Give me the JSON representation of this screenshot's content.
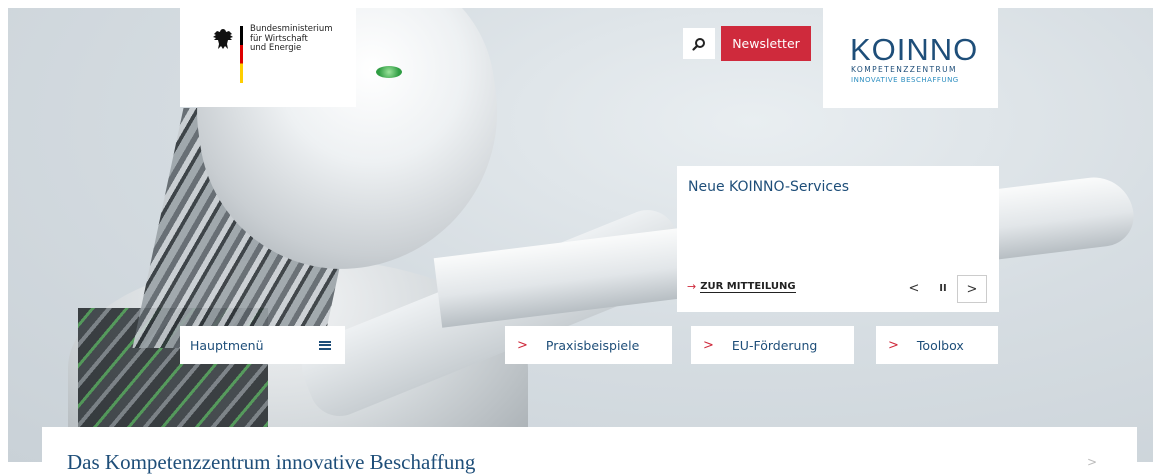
{
  "ministry": {
    "lines": [
      "Bundesministerium",
      "für Wirtschaft",
      "und Energie"
    ]
  },
  "header": {
    "search_icon": "search-icon",
    "newsletter_label": "Newsletter"
  },
  "logo": {
    "word": "KOINNO",
    "line1": "KOMPETENZZENTRUM",
    "line2": "INNOVATIVE BESCHAFFUNG"
  },
  "teaser": {
    "title": "Neue KOINNO-Services",
    "link_label": "ZUR MITTEILUNG",
    "prev_icon": "chevron-left-icon",
    "pause_icon": "pause-icon",
    "next_icon": "chevron-right-icon"
  },
  "nav": {
    "menu_label": "Hauptmenü",
    "items": [
      "Praxisbeispiele",
      "EU-Förderung",
      "Toolbox"
    ]
  },
  "intro": {
    "title": "Das Kompetenzzentrum innovative Beschaffung"
  },
  "colors": {
    "brand_blue": "#1e4e79",
    "accent_red": "#cf2a3c",
    "logo_light_blue": "#2e8fc1"
  }
}
